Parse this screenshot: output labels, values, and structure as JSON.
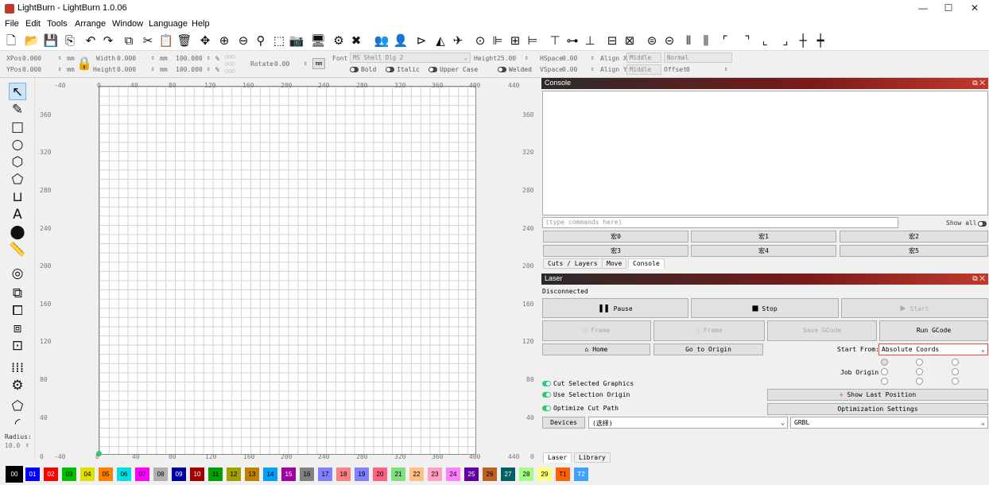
{
  "window": {
    "title": "LightBurn - LightBurn 1.0.06",
    "minimize": "—",
    "maximize": "☐",
    "close": "✕"
  },
  "menu": [
    "File",
    "Edit",
    "Tools",
    "Arrange",
    "Window",
    "Language",
    "Help"
  ],
  "props": {
    "xpos_label": "XPos",
    "xpos": "0.000",
    "ypos_label": "YPos",
    "ypos": "0.000",
    "unit": "mm",
    "width_label": "Width",
    "width": "0.000",
    "height_label": "Height",
    "height": "0.000",
    "scale_w": "100.000",
    "scale_h": "100.000",
    "pct": "%",
    "rotate_label": "Rotate",
    "rotate": "0.00",
    "mm_btn": "mm",
    "font_label": "Font",
    "font": "MS Shell Dlg 2",
    "fheight_label": "Height",
    "fheight": "25.00",
    "bold": "Bold",
    "italic": "Italic",
    "upper": "Upper Case",
    "welded": "Welded",
    "hspace_label": "HSpace",
    "hspace": "0.00",
    "vspace_label": "VSpace",
    "vspace": "0.00",
    "alignx_label": "Align X",
    "alignx": "Middle",
    "aligny_label": "Align Y",
    "aligny": "Middle",
    "normal": "Normal",
    "offset_label": "Offset",
    "offset": "0"
  },
  "ruler": {
    "top": [
      "-40",
      "0",
      "40",
      "80",
      "120",
      "160",
      "200",
      "240",
      "280",
      "320",
      "360",
      "400",
      "440"
    ],
    "bottom": [
      "0",
      "-40",
      "0",
      "40",
      "80",
      "120",
      "160",
      "200",
      "240",
      "280",
      "320",
      "360",
      "400",
      "440",
      "0"
    ],
    "left": [
      "360",
      "320",
      "280",
      "240",
      "200",
      "160",
      "120",
      "80",
      "40"
    ],
    "right": [
      "360",
      "320",
      "280",
      "240",
      "200",
      "160",
      "120",
      "80",
      "40"
    ],
    "radius_label": "Radius:",
    "radius": "10.0"
  },
  "console": {
    "title": "Console",
    "cmd_placeholder": "(type commands here)",
    "show_all": "Show all",
    "macros": [
      "宏0",
      "宏1",
      "宏2",
      "宏3",
      "宏4",
      "宏5"
    ],
    "tabs": [
      "Cuts / Layers",
      "Move",
      "Console"
    ]
  },
  "laser": {
    "title": "Laser",
    "status": "Disconnected",
    "pause": "Pause",
    "stop": "Stop",
    "start": "Start",
    "frame1": "Frame",
    "frame2": "Frame",
    "save_gcode": "Save GCode",
    "run_gcode": "Run GCode",
    "home": "Home",
    "go_origin": "Go to Origin",
    "start_from_label": "Start From:",
    "start_from": "Absolute Coords",
    "job_origin": "Job Origin",
    "cut_selected": "Cut Selected Graphics",
    "use_selection": "Use Selection Origin",
    "optimize_cut": "Optimize Cut Path",
    "show_last": "Show Last Position",
    "opt_settings": "Optimization Settings",
    "devices": "Devices",
    "device_sel": "(选择)",
    "controller": "GRBL",
    "tabs": [
      "Laser",
      "Library"
    ]
  },
  "palette": [
    {
      "n": "00",
      "c": "#000000",
      "t": "#ffffff"
    },
    {
      "n": "01",
      "c": "#0000ff",
      "t": "#ffffff"
    },
    {
      "n": "02",
      "c": "#ff0000",
      "t": "#ffffff"
    },
    {
      "n": "03",
      "c": "#00c000",
      "t": "#000000"
    },
    {
      "n": "04",
      "c": "#e0e000",
      "t": "#000000"
    },
    {
      "n": "05",
      "c": "#ff8000",
      "t": "#000000"
    },
    {
      "n": "06",
      "c": "#00e0e0",
      "t": "#000000"
    },
    {
      "n": "07",
      "c": "#ff00ff",
      "t": "#000000"
    },
    {
      "n": "08",
      "c": "#b0b0b0",
      "t": "#000000"
    },
    {
      "n": "09",
      "c": "#0000a0",
      "t": "#ffffff"
    },
    {
      "n": "10",
      "c": "#a00000",
      "t": "#ffffff"
    },
    {
      "n": "11",
      "c": "#00a000",
      "t": "#000000"
    },
    {
      "n": "12",
      "c": "#a0a000",
      "t": "#000000"
    },
    {
      "n": "13",
      "c": "#c08000",
      "t": "#000000"
    },
    {
      "n": "14",
      "c": "#00a0ff",
      "t": "#000000"
    },
    {
      "n": "15",
      "c": "#a000a0",
      "t": "#ffffff"
    },
    {
      "n": "16",
      "c": "#808080",
      "t": "#000000"
    },
    {
      "n": "17",
      "c": "#8080ff",
      "t": "#000000"
    },
    {
      "n": "18",
      "c": "#ff8080",
      "t": "#000000"
    },
    {
      "n": "19",
      "c": "#8080ff",
      "t": "#000000"
    },
    {
      "n": "20",
      "c": "#ff6080",
      "t": "#000000"
    },
    {
      "n": "21",
      "c": "#80e080",
      "t": "#000000"
    },
    {
      "n": "22",
      "c": "#ffc080",
      "t": "#000000"
    },
    {
      "n": "23",
      "c": "#ffa0c0",
      "t": "#000000"
    },
    {
      "n": "24",
      "c": "#ff80ff",
      "t": "#000000"
    },
    {
      "n": "25",
      "c": "#6000a0",
      "t": "#ffffff"
    },
    {
      "n": "26",
      "c": "#c06020",
      "t": "#000000"
    },
    {
      "n": "27",
      "c": "#006060",
      "t": "#ffffff"
    },
    {
      "n": "28",
      "c": "#a0ff80",
      "t": "#000000"
    },
    {
      "n": "29",
      "c": "#ffff80",
      "t": "#000000"
    },
    {
      "n": "T1",
      "c": "#ff6000",
      "t": "#000000"
    },
    {
      "n": "T2",
      "c": "#40a0ff",
      "t": "#ffffff"
    }
  ]
}
